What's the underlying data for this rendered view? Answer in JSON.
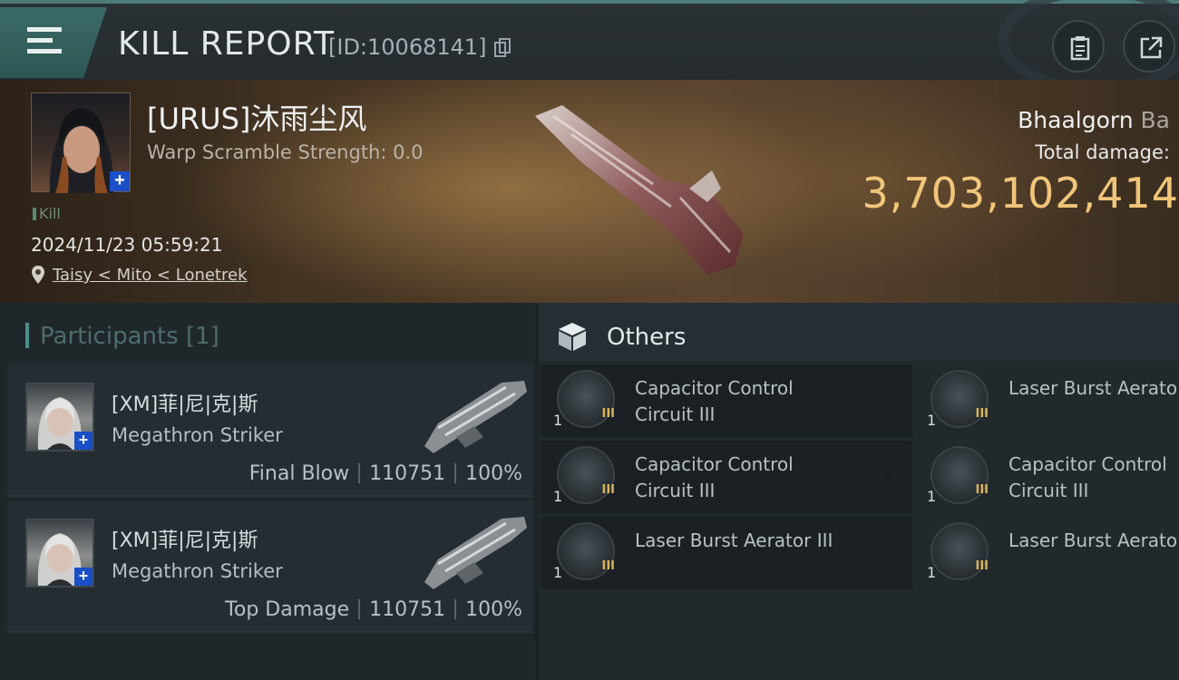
{
  "header": {
    "title": "KILL REPORT",
    "id_text": "[ID:10068141]"
  },
  "victim": {
    "name": "[URUS]沐雨尘风",
    "warp_scramble": "Warp Scramble Strength: 0.0",
    "kill_tag": "Kill",
    "timestamp": "2024/11/23 05:59:21",
    "location": "Taisy < Mito < Lonetrek",
    "ship_name": "Bhaalgorn",
    "ship_suffix": "Ba",
    "total_damage_label": "Total damage:",
    "total_damage_value": "3,703,102,414"
  },
  "participants": {
    "title": "Participants",
    "count": "[1]",
    "rows": [
      {
        "name": "[XM]菲|尼|克|斯",
        "ship": "Megathron Striker",
        "role": "Final Blow",
        "damage": "110751",
        "percent": "100%"
      },
      {
        "name": "[XM]菲|尼|克|斯",
        "ship": "Megathron Striker",
        "role": "Top Damage",
        "damage": "110751",
        "percent": "100%"
      }
    ]
  },
  "others": {
    "title": "Others",
    "items": [
      {
        "name": "Capacitor Control Circuit III",
        "qty": "1",
        "tier": "III",
        "removable": true
      },
      {
        "name": "Laser Burst Aerato III",
        "qty": "1",
        "tier": "III",
        "removable": false
      },
      {
        "name": "Capacitor Control Circuit III",
        "qty": "1",
        "tier": "III",
        "removable": true
      },
      {
        "name": "Capacitor Control Circuit III",
        "qty": "1",
        "tier": "III",
        "removable": false
      },
      {
        "name": "Laser Burst Aerator III",
        "qty": "1",
        "tier": "III",
        "removable": true
      },
      {
        "name": "Laser Burst Aerato III",
        "qty": "1",
        "tier": "III",
        "removable": false
      }
    ],
    "close_glyph": "✕"
  },
  "colors": {
    "accent_teal": "#4d7c78",
    "damage_gold": "#f1c57a",
    "plus_blue": "#1a4fc7"
  }
}
